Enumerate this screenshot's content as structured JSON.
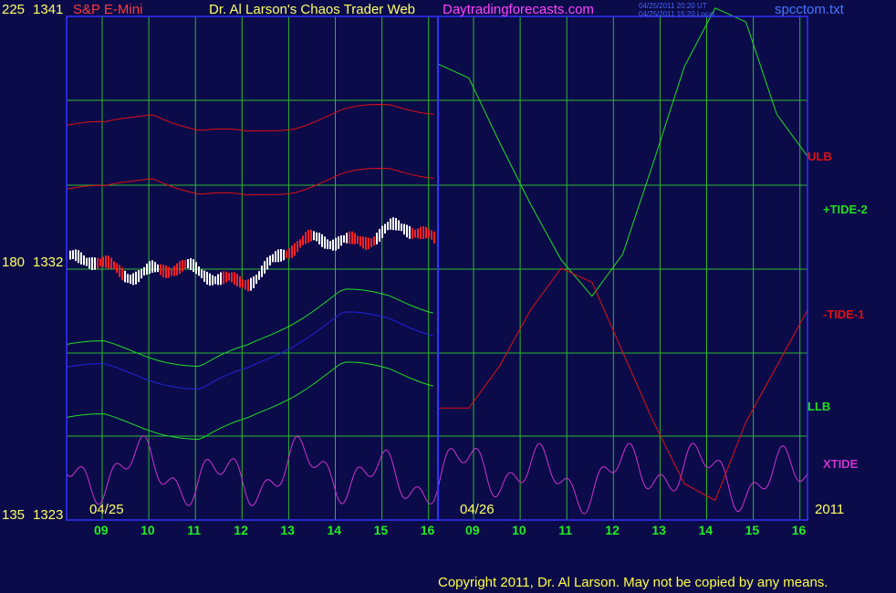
{
  "header": {
    "symbol": "S&P E-Mini",
    "title": "Dr. Al Larson's Chaos Trader Web",
    "site": "Daytradingforecasts.com",
    "time_ut": "04/25/2011 20:20 UT",
    "time_local": "04/25/2011 15:20 Local",
    "file": "spcctom.txt"
  },
  "left_axis": {
    "top_left": "225",
    "top_right": "1341",
    "mid_left": "180",
    "mid_right": "1332",
    "bottom_left": "135",
    "bottom_right": "1323"
  },
  "footer": {
    "date_left": "04/25",
    "date_mid": "04/26",
    "year": "2011",
    "copyright": "Copyright 2011, Dr. Al Larson. May not be copied by any means."
  },
  "colors": {
    "background": "#0b0b4a",
    "grid": "#2eb82e",
    "frame": "#3333ff",
    "red": "#e01010",
    "green": "#22dd22",
    "magenta": "#cc33cc",
    "yellow": "#ffff66",
    "blue": "#2222dd",
    "price_up": "#ffffff",
    "price_down": "#ff2020"
  },
  "chart_data": {
    "type": "line",
    "x_ticks": [
      "09",
      "10",
      "11",
      "12",
      "13",
      "14",
      "15",
      "16",
      "09",
      "10",
      "11",
      "12",
      "13",
      "14",
      "15",
      "16"
    ],
    "ylim_price": [
      1323,
      1341
    ],
    "ylim_scale": [
      135,
      225
    ],
    "series_labels": [
      {
        "name": "ULB",
        "color": "#e01010"
      },
      {
        "name": "+TIDE-2",
        "color": "#22dd22"
      },
      {
        "name": "-TIDE-1",
        "color": "#e01010"
      },
      {
        "name": "LLB",
        "color": "#22dd22"
      },
      {
        "name": "XTIDE",
        "color": "#cc33cc"
      }
    ],
    "forecast_tide2": [
      [
        16,
        1339.3
      ],
      [
        16.5,
        1338.8
      ],
      [
        17,
        1336.5
      ],
      [
        17.5,
        1334.3
      ],
      [
        18,
        1332.3
      ],
      [
        18.5,
        1331
      ],
      [
        19,
        1332.5
      ],
      [
        19.5,
        1335.8
      ],
      [
        20,
        1339.2
      ],
      [
        20.5,
        1341.3
      ],
      [
        21,
        1340.8
      ],
      [
        21.5,
        1337.5
      ],
      [
        22,
        1336
      ]
    ],
    "forecast_tide1": [
      [
        16,
        1327
      ],
      [
        16.5,
        1327
      ],
      [
        17,
        1328.5
      ],
      [
        17.5,
        1330.5
      ],
      [
        18,
        1332
      ],
      [
        18.5,
        1331.5
      ],
      [
        19,
        1329
      ],
      [
        19.5,
        1326.5
      ],
      [
        20,
        1324.3
      ],
      [
        20.5,
        1323.7
      ],
      [
        21,
        1326.5
      ],
      [
        21.5,
        1328.5
      ],
      [
        22,
        1330.5
      ]
    ],
    "price_band_high": [
      [
        9,
        1334.5
      ],
      [
        10,
        1335
      ],
      [
        11,
        1334.3
      ],
      [
        12,
        1334.2
      ],
      [
        13,
        1334.5
      ],
      [
        14,
        1335
      ],
      [
        15,
        1335.2
      ],
      [
        16,
        1335
      ]
    ],
    "price_band_low": [
      [
        9,
        1329.6
      ],
      [
        10,
        1329.2
      ],
      [
        11,
        1328.8
      ],
      [
        12,
        1329.5
      ],
      [
        13,
        1330.5
      ],
      [
        14,
        1331.5
      ],
      [
        15,
        1331.3
      ],
      [
        16,
        1330.8
      ]
    ]
  }
}
